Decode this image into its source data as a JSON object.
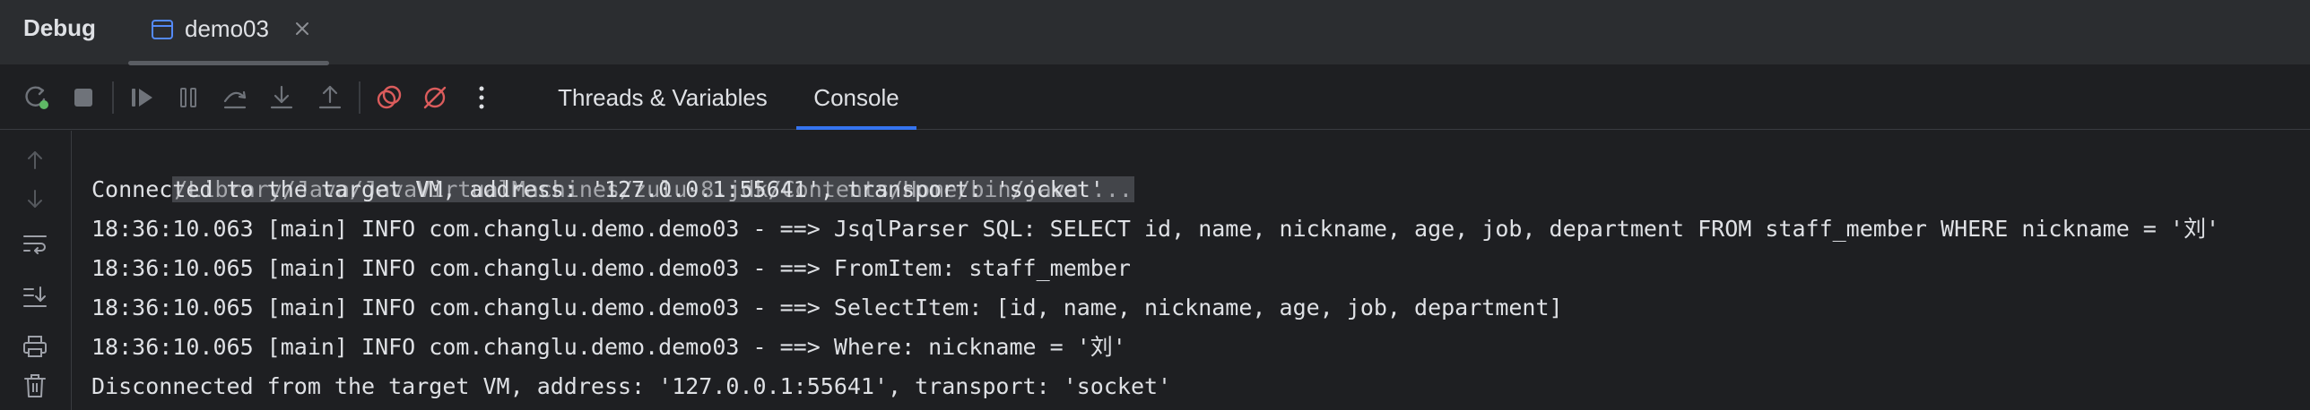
{
  "title_bar": {
    "title": "Debug",
    "session_tab": {
      "label": "demo03",
      "icon": "application-window-icon"
    }
  },
  "toolbar": {
    "buttons": [
      {
        "name": "rerun-button",
        "icon": "rerun-icon"
      },
      {
        "name": "stop-button",
        "icon": "stop-icon"
      },
      {
        "name": "resume-button",
        "icon": "resume-icon"
      },
      {
        "name": "pause-button",
        "icon": "pause-icon"
      },
      {
        "name": "step-over-button",
        "icon": "step-over-icon"
      },
      {
        "name": "step-into-button",
        "icon": "step-into-icon"
      },
      {
        "name": "step-out-button",
        "icon": "step-out-icon"
      },
      {
        "name": "view-breakpoints-button",
        "icon": "breakpoints-icon"
      },
      {
        "name": "mute-breakpoints-button",
        "icon": "mute-breakpoints-icon"
      },
      {
        "name": "more-button",
        "icon": "more-vertical-icon"
      }
    ],
    "tabs": [
      {
        "label": "Threads & Variables",
        "active": false
      },
      {
        "label": "Console",
        "active": true
      }
    ]
  },
  "gutter": {
    "buttons": [
      {
        "name": "scroll-up-button",
        "icon": "arrow-up-icon"
      },
      {
        "name": "scroll-down-button",
        "icon": "arrow-down-icon"
      },
      {
        "name": "soft-wrap-button",
        "icon": "soft-wrap-icon"
      },
      {
        "name": "scroll-to-end-button",
        "icon": "scroll-to-end-icon"
      },
      {
        "name": "print-button",
        "icon": "printer-icon"
      },
      {
        "name": "clear-all-button",
        "icon": "trash-icon"
      }
    ]
  },
  "console": {
    "command_line": "/Library/Java/JavaVirtualMachines/zulu-8.jdk/Contents/Home/bin/java ...",
    "lines": [
      "Connected to the target VM, address: '127.0.0.1:55641', transport: 'socket'",
      "18:36:10.063 [main] INFO com.changlu.demo.demo03 - ==> JsqlParser SQL: SELECT id, name, nickname, age, job, department FROM staff_member WHERE nickname = '刘'",
      "18:36:10.065 [main] INFO com.changlu.demo.demo03 - ==> FromItem: staff_member",
      "18:36:10.065 [main] INFO com.changlu.demo.demo03 - ==> SelectItem: [id, name, nickname, age, job, department]",
      "18:36:10.065 [main] INFO com.changlu.demo.demo03 - ==> Where: nickname = '刘'",
      "Disconnected from the target VM, address: '127.0.0.1:55641', transport: 'socket'"
    ]
  },
  "colors": {
    "background": "#1e1f22",
    "title_bar": "#2b2d30",
    "accent": "#3574f0",
    "icon_gray": "#6f737a",
    "breakpoint_red": "#db5c5c",
    "rerun_green": "#5fb865",
    "text": "#dfe1e5"
  }
}
